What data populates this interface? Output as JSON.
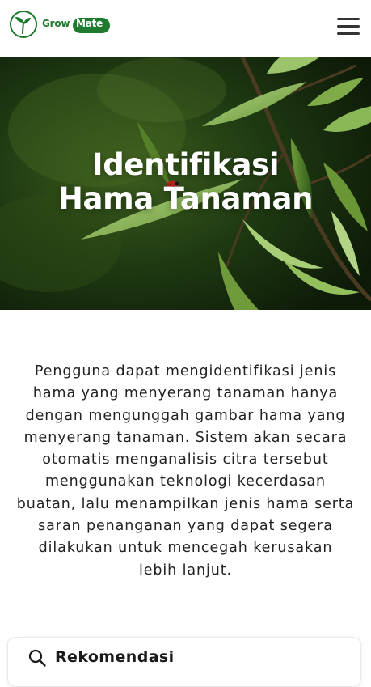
{
  "brand": {
    "grow": "Grow",
    "mate": "Mate",
    "color": "#1e7a2e"
  },
  "nav": {
    "menu_icon": "hamburger-menu-icon"
  },
  "hero": {
    "title_line1": "Identifikasi",
    "title_line2": "Hama Tanaman"
  },
  "description": {
    "lines": [
      "Pengguna dapat mengidentifikasi jenis",
      "hama yang menyerang tanaman hanya",
      "dengan mengunggah gambar hama yang",
      "menyerang tanaman. Sistem akan secara",
      "otomatis menganalisis citra tersebut",
      "menggunakan teknologi kecerdasan",
      "buatan, lalu menampilkan jenis hama serta",
      "saran penanganan yang dapat segera",
      "dilakukan untuk mencegah kerusakan",
      "lebih lanjut."
    ]
  },
  "recommendation_card": {
    "icon": "search-icon",
    "title": "Rekomendasi"
  }
}
